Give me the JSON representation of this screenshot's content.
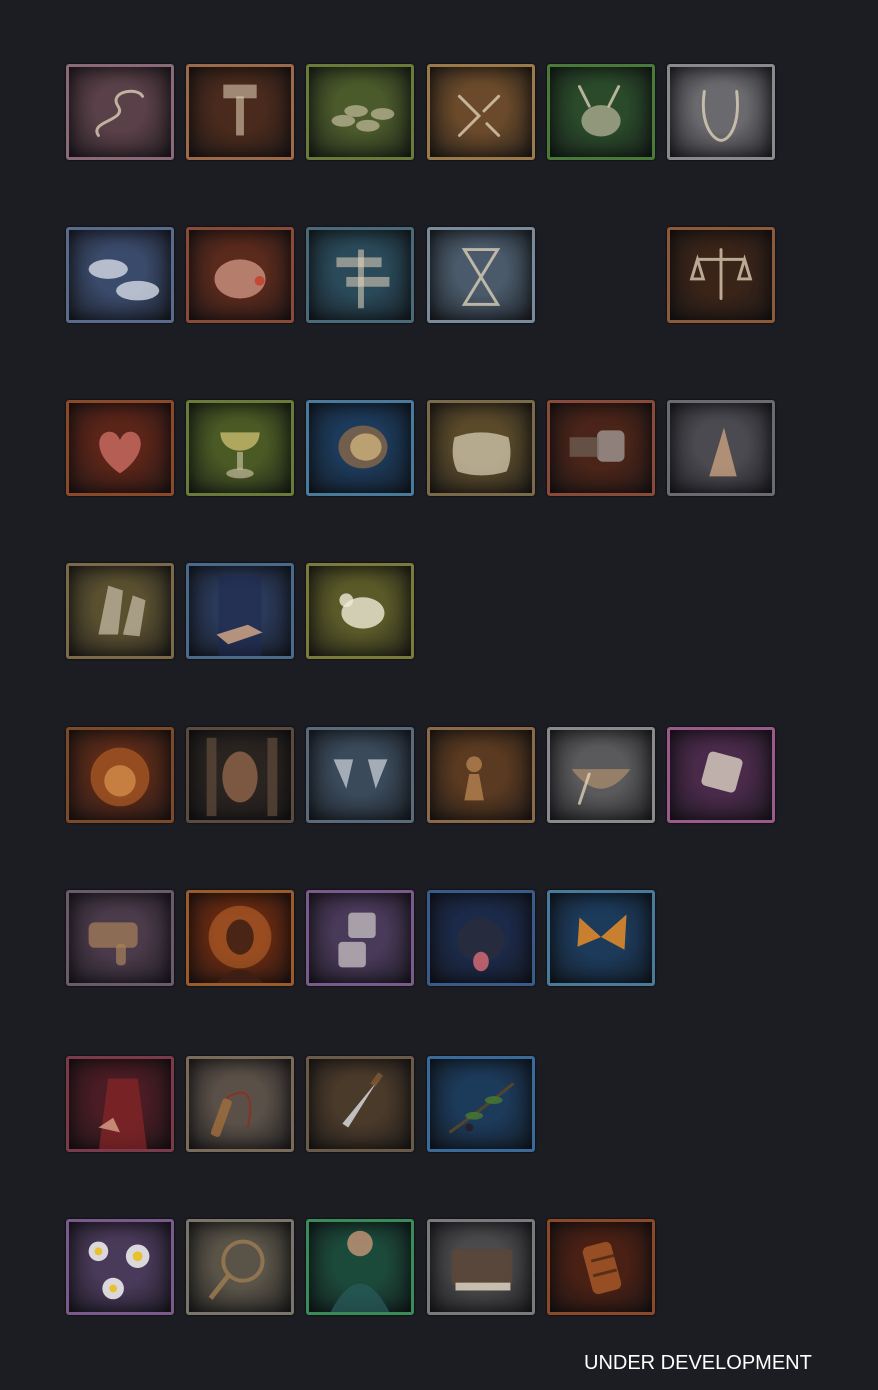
{
  "footer_text": "UNDER DEVELOPMENT",
  "rows": [
    [
      {
        "icon": "snake-icon",
        "bg": "#5a4048",
        "border": "#8a6a78"
      },
      {
        "icon": "hammer-icon",
        "bg": "#4a2a1c",
        "border": "#9a6a4a"
      },
      {
        "icon": "coins-icon",
        "bg": "#4a5a2a",
        "border": "#6a7a3a"
      },
      {
        "icon": "broken-hourglass-icon",
        "bg": "#6a4a2a",
        "border": "#9a7a4a"
      },
      {
        "icon": "braying-donkey-icon",
        "bg": "#2a4a2a",
        "border": "#4a7a3a"
      },
      {
        "icon": "iron-collar-icon",
        "bg": "#6a6a6e",
        "border": "#8a8a8e"
      }
    ],
    [
      {
        "icon": "clouds-icon",
        "bg": "#3a4a6a",
        "border": "#5a6a8a"
      },
      {
        "icon": "pig-head-icon",
        "bg": "#5a2a1c",
        "border": "#8a4a3a"
      },
      {
        "icon": "signpost-icon",
        "bg": "#2a4a5a",
        "border": "#4a6a7a"
      },
      {
        "icon": "hourglass-icon",
        "bg": "#4a5a6a",
        "border": "#7a8a9a"
      },
      null,
      {
        "icon": "scales-icon",
        "bg": "#3a2418",
        "border": "#8a5a3a"
      }
    ],
    [
      {
        "icon": "burning-heart-icon",
        "bg": "#5a2418",
        "border": "#8a4a2a"
      },
      {
        "icon": "chalice-icon",
        "bg": "#4a5a24",
        "border": "#6a7a3a"
      },
      {
        "icon": "coin-bowl-icon",
        "bg": "#1c3a5a",
        "border": "#4a7a9a"
      },
      {
        "icon": "pillow-icon",
        "bg": "#5a4a2a",
        "border": "#7a6a4a"
      },
      {
        "icon": "gauntlet-fist-icon",
        "bg": "#4a2418",
        "border": "#8a4a3a"
      },
      {
        "icon": "praying-hands-icon",
        "bg": "#4a4a50",
        "border": "#6a6a70"
      }
    ],
    [
      {
        "icon": "feet-icon",
        "bg": "#5a5030",
        "border": "#7a6a4a"
      },
      {
        "icon": "hand-on-chest-icon",
        "bg": "#2a3a5a",
        "border": "#4a6a8a"
      },
      {
        "icon": "chicken-icon",
        "bg": "#5a5a28",
        "border": "#7a7a3a"
      },
      null,
      null,
      null
    ],
    [
      {
        "icon": "lion-icon",
        "bg": "#5a2a18",
        "border": "#7a4a2a"
      },
      {
        "icon": "peeking-face-icon",
        "bg": "#2a2420",
        "border": "#5a4a40"
      },
      {
        "icon": "goblets-icon",
        "bg": "#3a4a5a",
        "border": "#5a6a7a"
      },
      {
        "icon": "pawn-icon",
        "bg": "#5a3a20",
        "border": "#8a6a4a"
      },
      {
        "icon": "bowl-spoon-icon",
        "bg": "#5a5a5c",
        "border": "#8a8a8c"
      },
      {
        "icon": "dice-icon",
        "bg": "#4a2a4a",
        "border": "#9a5a8a"
      }
    ],
    [
      {
        "icon": "thumbs-down-icon",
        "bg": "#4a3a4a",
        "border": "#6a5a6a"
      },
      {
        "icon": "haloed-head-icon",
        "bg": "#6a2a10",
        "border": "#9a5a2a"
      },
      {
        "icon": "padlocks-icon",
        "bg": "#4a3a5a",
        "border": "#7a5a8a"
      },
      {
        "icon": "dog-icon",
        "bg": "#1c2a4a",
        "border": "#3a5a8a"
      },
      {
        "icon": "butterfly-icon",
        "bg": "#1c3a5a",
        "border": "#4a7a9a"
      },
      null
    ],
    [
      {
        "icon": "robed-figure-icon",
        "bg": "#4a1c24",
        "border": "#7a3a4a"
      },
      {
        "icon": "whip-icon",
        "bg": "#5a5048",
        "border": "#7a6a5a"
      },
      {
        "icon": "dagger-icon",
        "bg": "#4a3a2a",
        "border": "#6a5a4a"
      },
      {
        "icon": "olive-branch-icon",
        "bg": "#1c3a5a",
        "border": "#3a6a9a"
      },
      null,
      null
    ],
    [
      {
        "icon": "daisies-icon",
        "bg": "#4a3a5a",
        "border": "#7a5a8a"
      },
      {
        "icon": "magnifier-map-icon",
        "bg": "#5a5448",
        "border": "#7a746a"
      },
      {
        "icon": "child-portrait-icon",
        "bg": "#1c4a3a",
        "border": "#3a8a5a"
      },
      {
        "icon": "book-icon",
        "bg": "#4a4a4c",
        "border": "#7a7a7c"
      },
      {
        "icon": "torch-icon",
        "bg": "#4a2014",
        "border": "#8a4a2a"
      },
      null
    ]
  ]
}
